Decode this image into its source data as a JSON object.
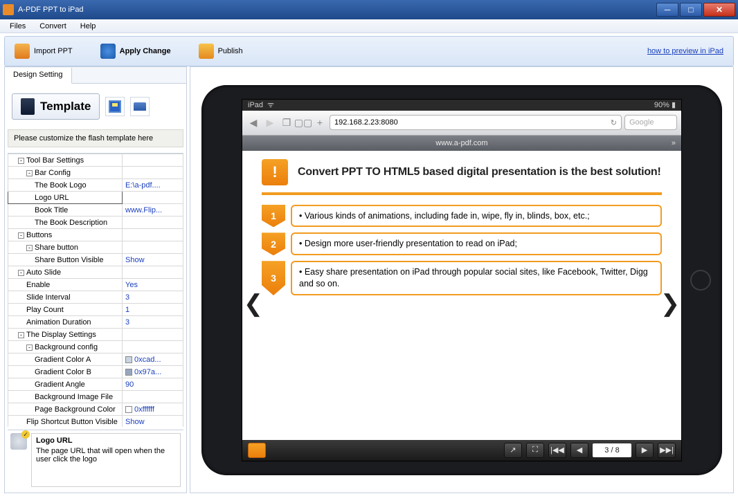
{
  "window": {
    "title": "A-PDF PPT to iPad"
  },
  "menu": {
    "files": "Files",
    "convert": "Convert",
    "help": "Help"
  },
  "toolbar": {
    "import": "Import PPT",
    "apply": "Apply Change",
    "publish": "Publish",
    "preview_link": "how to preview in iPad"
  },
  "sidebar": {
    "tab": "Design Setting",
    "template_btn": "Template",
    "customize_note": "Please customize the flash template here",
    "rows": [
      {
        "k": "Tool Bar Settings",
        "v": "",
        "lvl": 0,
        "tog": "-"
      },
      {
        "k": "Bar Config",
        "v": "",
        "lvl": 1,
        "tog": "-"
      },
      {
        "k": "The Book Logo",
        "v": "E:\\a-pdf....",
        "lvl": 2
      },
      {
        "k": "Logo URL",
        "v": "",
        "lvl": 2,
        "sel": true
      },
      {
        "k": "Book Title",
        "v": "www.Flip...",
        "lvl": 2
      },
      {
        "k": "The Book Description",
        "v": "",
        "lvl": 2
      },
      {
        "k": "Buttons",
        "v": "",
        "lvl": 0,
        "tog": "-"
      },
      {
        "k": "Share button",
        "v": "",
        "lvl": 1,
        "tog": "-"
      },
      {
        "k": "Share Button Visible",
        "v": "Show",
        "lvl": 2
      },
      {
        "k": "Auto Slide",
        "v": "",
        "lvl": 0,
        "tog": "-"
      },
      {
        "k": "Enable",
        "v": "Yes",
        "lvl": 1
      },
      {
        "k": "Slide Interval",
        "v": "3",
        "lvl": 1
      },
      {
        "k": "Play Count",
        "v": "1",
        "lvl": 1
      },
      {
        "k": "Animation Duration",
        "v": "3",
        "lvl": 1
      },
      {
        "k": "The Display Settings",
        "v": "",
        "lvl": 0,
        "tog": "-"
      },
      {
        "k": "Background config",
        "v": "",
        "lvl": 1,
        "tog": "-"
      },
      {
        "k": "Gradient Color A",
        "v": "0xcad...",
        "lvl": 2,
        "sw": "#cad4e2"
      },
      {
        "k": "Gradient Color B",
        "v": "0x97a...",
        "lvl": 2,
        "sw": "#97a6c0"
      },
      {
        "k": "Gradient Angle",
        "v": "90",
        "lvl": 2
      },
      {
        "k": "Background Image File",
        "v": "",
        "lvl": 2
      },
      {
        "k": "Page Background Color",
        "v": "0xffffff",
        "lvl": 2,
        "sw": "#ffffff"
      },
      {
        "k": "Flip Shortcut Button Visible",
        "v": "Show",
        "lvl": 1
      }
    ],
    "desc": {
      "title": "Logo URL",
      "body": "The page URL that will open when the user click the logo"
    }
  },
  "ipad": {
    "status_left": "iPad",
    "status_right": "90%",
    "address": "192.168.2.23:8080",
    "search_placeholder": "Google",
    "tab_title": "www.a-pdf.com",
    "slide": {
      "heading": "Convert PPT TO HTML5 based digital presentation is the best solution!",
      "bullets": [
        "Various kinds of animations, including fade in, wipe, fly in, blinds, box, etc.;",
        "Design more user-friendly presentation to read on iPad;",
        "Easy share presentation on iPad through popular social sites, like Facebook, Twitter, Digg and so on."
      ],
      "page_indicator": "3 / 8"
    }
  }
}
